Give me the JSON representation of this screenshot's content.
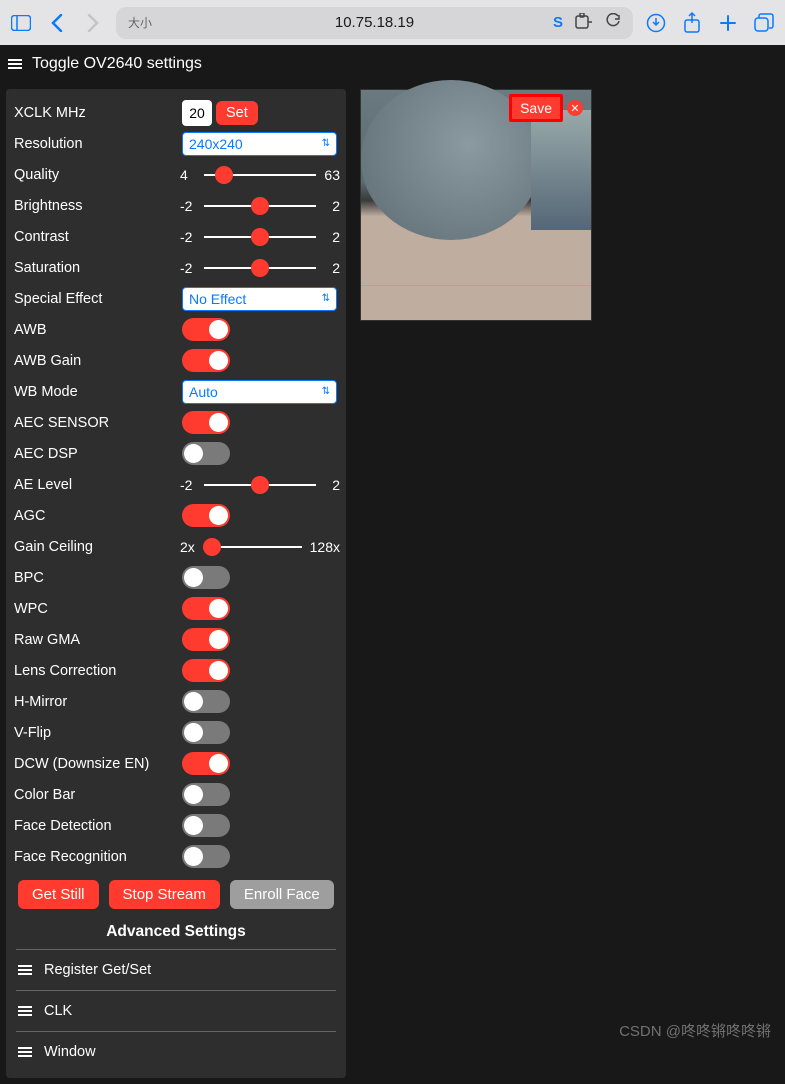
{
  "browser": {
    "size_label": "大小",
    "url": "10.75.18.19"
  },
  "header": {
    "title": "Toggle OV2640 settings"
  },
  "settings": {
    "xclk": {
      "label": "XCLK MHz",
      "value": "20",
      "set": "Set"
    },
    "resolution": {
      "label": "Resolution",
      "value": "240x240"
    },
    "quality": {
      "label": "Quality",
      "min": "4",
      "max": "63",
      "pos": 18
    },
    "brightness": {
      "label": "Brightness",
      "min": "-2",
      "max": "2",
      "pos": 50
    },
    "contrast": {
      "label": "Contrast",
      "min": "-2",
      "max": "2",
      "pos": 50
    },
    "saturation": {
      "label": "Saturation",
      "min": "-2",
      "max": "2",
      "pos": 50
    },
    "special": {
      "label": "Special Effect",
      "value": "No Effect"
    },
    "awb": {
      "label": "AWB",
      "on": true
    },
    "awbgain": {
      "label": "AWB Gain",
      "on": true
    },
    "wbmode": {
      "label": "WB Mode",
      "value": "Auto"
    },
    "aecsensor": {
      "label": "AEC SENSOR",
      "on": true
    },
    "aecdsp": {
      "label": "AEC DSP",
      "on": false
    },
    "aelevel": {
      "label": "AE Level",
      "min": "-2",
      "max": "2",
      "pos": 50
    },
    "agc": {
      "label": "AGC",
      "on": true
    },
    "gainceiling": {
      "label": "Gain Ceiling",
      "min": "2x",
      "max": "128x",
      "pos": 8
    },
    "bpc": {
      "label": "BPC",
      "on": false
    },
    "wpc": {
      "label": "WPC",
      "on": true
    },
    "rawgma": {
      "label": "Raw GMA",
      "on": true
    },
    "lenscorr": {
      "label": "Lens Correction",
      "on": true
    },
    "hmirror": {
      "label": "H-Mirror",
      "on": false
    },
    "vflip": {
      "label": "V-Flip",
      "on": false
    },
    "dcw": {
      "label": "DCW (Downsize EN)",
      "on": true
    },
    "colorbar": {
      "label": "Color Bar",
      "on": false
    },
    "facedet": {
      "label": "Face Detection",
      "on": false
    },
    "facerec": {
      "label": "Face Recognition",
      "on": false
    }
  },
  "actions": {
    "getstill": "Get Still",
    "stopstream": "Stop Stream",
    "enrollface": "Enroll Face"
  },
  "advanced": {
    "title": "Advanced Settings",
    "reg": "Register Get/Set",
    "clk": "CLK",
    "window": "Window"
  },
  "preview": {
    "save": "Save"
  },
  "watermark": "CSDN @咚咚锵咚咚锵"
}
